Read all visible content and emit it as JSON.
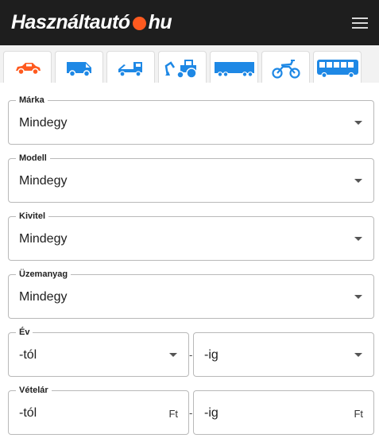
{
  "header": {
    "logo_left": "Használtautó",
    "logo_right": "hu",
    "brand_color": "#ff5a1f"
  },
  "menu": {
    "icon": "hamburger-menu-icon"
  },
  "vehicle_tabs": [
    {
      "icon": "car-icon",
      "active": true
    },
    {
      "icon": "van-icon",
      "active": false
    },
    {
      "icon": "tow-truck-icon",
      "active": false
    },
    {
      "icon": "tractor-icon",
      "active": false
    },
    {
      "icon": "trailer-truck-icon",
      "active": false
    },
    {
      "icon": "motorcycle-icon",
      "active": false
    },
    {
      "icon": "bus-icon",
      "active": false
    }
  ],
  "fields": {
    "marka": {
      "label": "Márka",
      "value": "Mindegy"
    },
    "modell": {
      "label": "Modell",
      "value": "Mindegy"
    },
    "kivitel": {
      "label": "Kivitel",
      "value": "Mindegy"
    },
    "uzemanyag": {
      "label": "Üzemanyag",
      "value": "Mindegy"
    },
    "ev": {
      "label": "Év",
      "from": "-tól",
      "separator": "-",
      "to": "-ig"
    },
    "vetelar": {
      "label": "Vételár",
      "from": "-tól",
      "separator": "-",
      "to": "-ig",
      "unit": "Ft"
    }
  },
  "colors": {
    "active_icon": "#ff5a1f",
    "inactive_icon": "#1e88e5",
    "header_bg": "#1e1e1e"
  }
}
